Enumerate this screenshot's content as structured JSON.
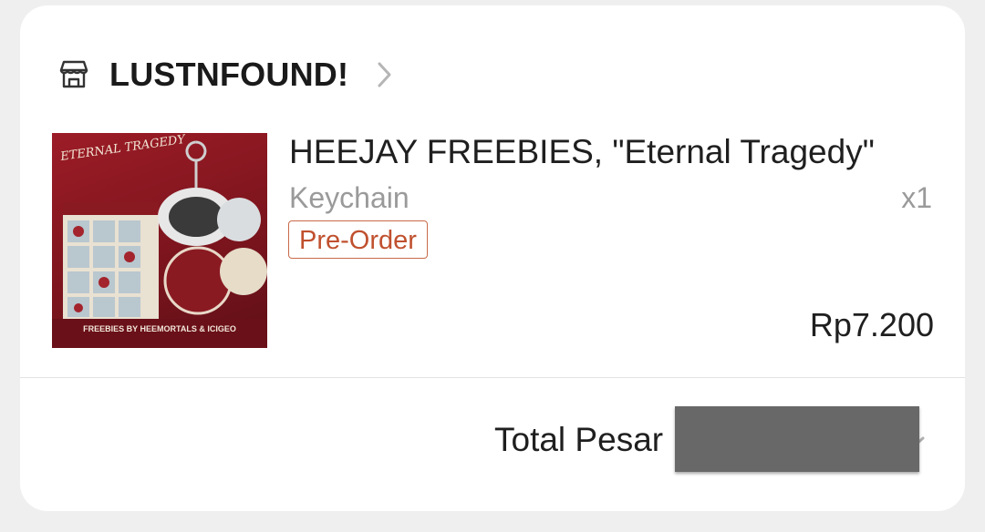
{
  "shop": {
    "name": "LUSTNFOUND!",
    "icon": "store-icon"
  },
  "item": {
    "title": "HEEJAY FREEBIES, \"Eternal Tragedy\"",
    "variant": "Keychain",
    "quantity": "x1",
    "badge": "Pre-Order",
    "price": "Rp7.200",
    "thumbnail": {
      "headline": "ETERNAL TRAGEDY",
      "footer": "FREEBIES BY HEEMORTALS & ICIGEO"
    }
  },
  "order": {
    "total_label": "Total Pesar"
  },
  "colors": {
    "badge": "#c0502e",
    "redaction": "#686868",
    "background": "#efefef"
  }
}
